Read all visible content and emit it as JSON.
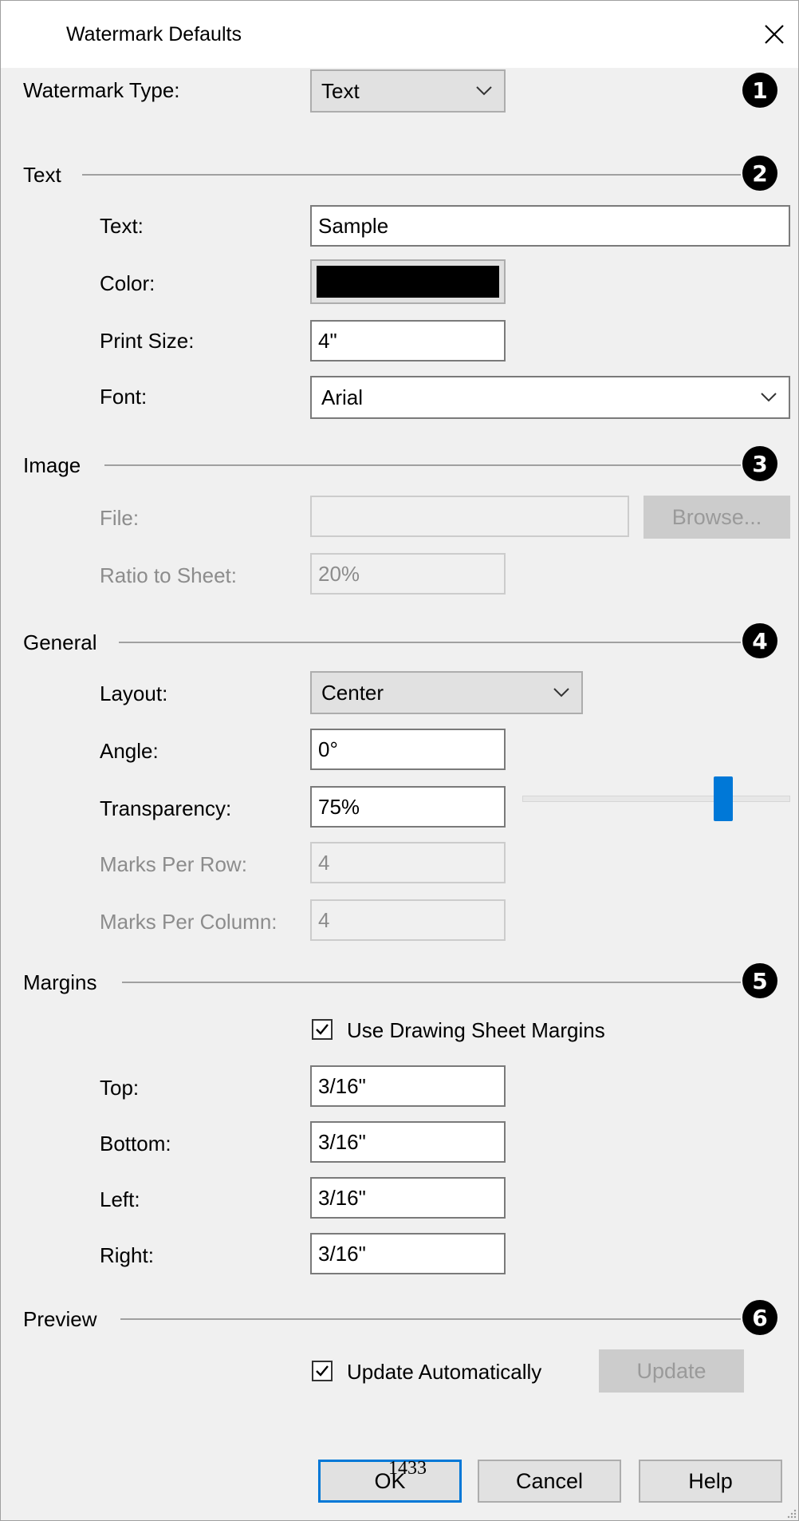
{
  "dialog": {
    "title": "Watermark Defaults",
    "close_icon": "close-icon"
  },
  "watermark_type": {
    "label": "Watermark Type:",
    "value": "Text"
  },
  "badges": [
    "1",
    "2",
    "3",
    "4",
    "5",
    "6"
  ],
  "text_section": {
    "heading": "Text",
    "text_label": "Text:",
    "text_value": "Sample",
    "color_label": "Color:",
    "color_value": "#000000",
    "print_size_label": "Print Size:",
    "print_size_value": "4\"",
    "font_label": "Font:",
    "font_value": "Arial"
  },
  "image_section": {
    "heading": "Image",
    "file_label": "File:",
    "file_value": "",
    "browse_label": "Browse...",
    "ratio_label": "Ratio to Sheet:",
    "ratio_value": "20%"
  },
  "general_section": {
    "heading": "General",
    "layout_label": "Layout:",
    "layout_value": "Center",
    "angle_label": "Angle:",
    "angle_value": "0°",
    "transparency_label": "Transparency:",
    "transparency_value": "75%",
    "transparency_slider_fraction": 0.75,
    "marks_row_label": "Marks Per Row:",
    "marks_row_value": "4",
    "marks_col_label": "Marks Per Column:",
    "marks_col_value": "4"
  },
  "margins_section": {
    "heading": "Margins",
    "use_sheet_margins_label": "Use Drawing Sheet Margins",
    "use_sheet_margins_checked": true,
    "top_label": "Top:",
    "top_value": "3/16\"",
    "bottom_label": "Bottom:",
    "bottom_value": "3/16\"",
    "left_label": "Left:",
    "left_value": "3/16\"",
    "right_label": "Right:",
    "right_value": "3/16\""
  },
  "preview_section": {
    "heading": "Preview",
    "update_auto_label": "Update Automatically",
    "update_auto_checked": true,
    "update_button": "Update"
  },
  "footer": {
    "ok": "OK",
    "cancel": "Cancel",
    "help": "Help"
  },
  "page_number": "1433",
  "colors": {
    "accent": "#0078d7",
    "dialog_bg": "#f0f0f0",
    "badge": "#000000"
  }
}
